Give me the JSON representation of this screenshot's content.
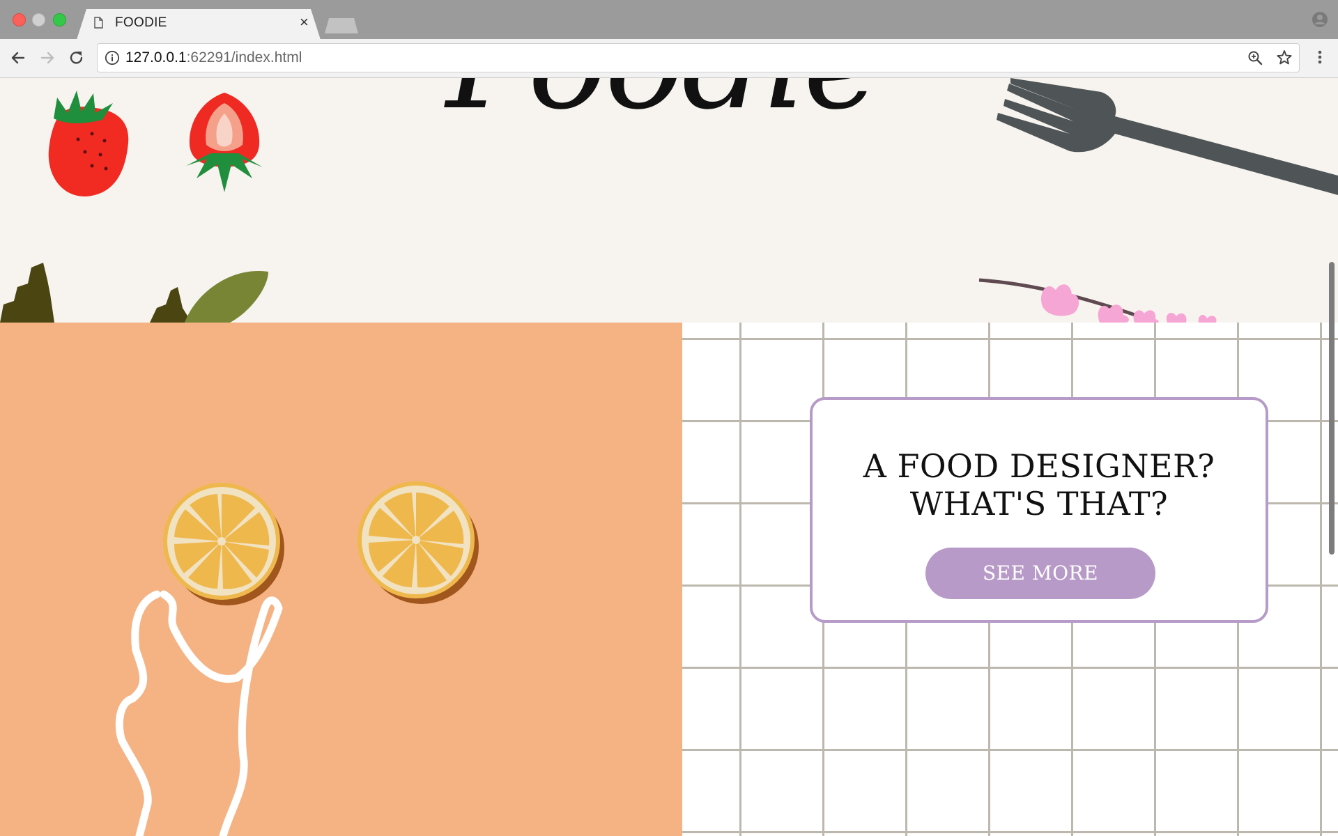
{
  "browser": {
    "tab": {
      "title": "FOODIE",
      "close_glyph": "×",
      "icon": "document-icon"
    },
    "new_tab_icon": "new-tab-icon",
    "profile_icon": "profile-icon",
    "nav": {
      "back_icon": "back-arrow-icon",
      "forward_icon": "forward-arrow-icon",
      "reload_icon": "reload-icon"
    },
    "address": {
      "host": "127.0.0.1",
      "rest": ":62291/index.html",
      "info_icon": "info-icon",
      "zoom_icon": "zoom-icon",
      "bookmark_icon": "star-icon"
    },
    "menu_icon": "more-vert-icon",
    "colors": {
      "chrome": "#9b9b9b",
      "toolbar": "#f2f2f2"
    }
  },
  "hero": {
    "title": "Foodie",
    "background": "#f7f4ef",
    "decorations": [
      "strawberry",
      "strawberry-half",
      "leaves",
      "fork",
      "pink-flowers"
    ]
  },
  "promo": {
    "card_title_line1": "A FOOD DESIGNER?",
    "card_title_line2": "WHAT'S THAT?",
    "button_label": "SEE MORE",
    "colors": {
      "accent": "#b79ac7",
      "orange_panel": "#f5b383",
      "grid_line": "#bdb8ae"
    }
  },
  "illustration": {
    "items": [
      "lemon-slice",
      "lemon-slice",
      "hand-outline"
    ]
  }
}
